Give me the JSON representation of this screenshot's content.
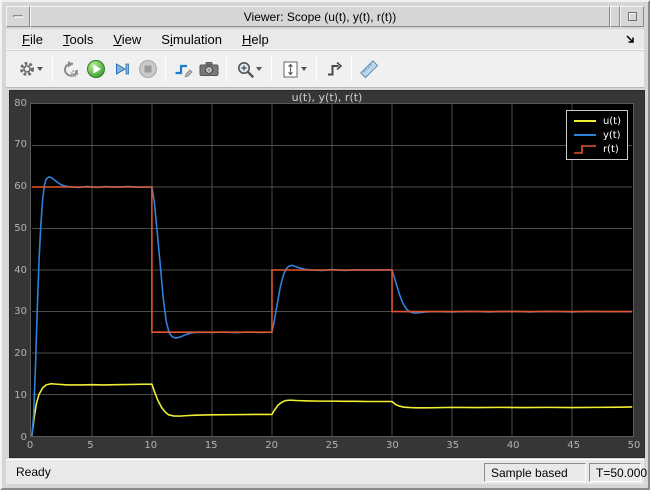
{
  "window": {
    "title": "Viewer: Scope (u(t), y(t), r(t))"
  },
  "menu": {
    "items": [
      {
        "label": "File",
        "mnemonic": 0
      },
      {
        "label": "Tools",
        "mnemonic": 0
      },
      {
        "label": "View",
        "mnemonic": 0
      },
      {
        "label": "Simulation",
        "mnemonic": 1
      },
      {
        "label": "Help",
        "mnemonic": 0
      }
    ]
  },
  "toolbar": {
    "buttons": [
      "settings-gear",
      "step-back",
      "run",
      "step-forward",
      "stop",
      "highlight-simulink-block",
      "snapshot-camera",
      "zoom-in",
      "scale-axes",
      "triggers",
      "measurements-ruler"
    ]
  },
  "status": {
    "left": "Ready",
    "mode": "Sample based",
    "time": "T=50.000"
  },
  "chart_data": {
    "type": "line",
    "title": "u(t), y(t), r(t)",
    "xlim": [
      0,
      50
    ],
    "ylim": [
      0,
      80
    ],
    "xticks": [
      0,
      5,
      10,
      15,
      20,
      25,
      30,
      35,
      40,
      45,
      50
    ],
    "yticks": [
      0,
      10,
      20,
      30,
      40,
      50,
      60,
      70,
      80
    ],
    "grid": true,
    "background": "#000000",
    "grid_color": "#4d4d4d",
    "tick_color": "#b3b3b3",
    "legend_position": "top-right",
    "series": [
      {
        "name": "u(t)",
        "color": "#f0ee33",
        "legend_glyph": "line",
        "points": [
          [
            0,
            0
          ],
          [
            0.2,
            4.5
          ],
          [
            0.4,
            8
          ],
          [
            0.6,
            10
          ],
          [
            0.9,
            11.6
          ],
          [
            1.2,
            12.3
          ],
          [
            1.6,
            12.6
          ],
          [
            2,
            12.5
          ],
          [
            3,
            12.3
          ],
          [
            4,
            12.3
          ],
          [
            5,
            12.35
          ],
          [
            6,
            12.3
          ],
          [
            7,
            12.35
          ],
          [
            8,
            12.4
          ],
          [
            9,
            12.45
          ],
          [
            10,
            12.5
          ],
          [
            10.2,
            10.8
          ],
          [
            10.5,
            8.6
          ],
          [
            10.8,
            6.9
          ],
          [
            11.1,
            5.8
          ],
          [
            11.4,
            5.1
          ],
          [
            11.8,
            4.85
          ],
          [
            12.3,
            4.8
          ],
          [
            12.9,
            4.9
          ],
          [
            13.6,
            5
          ],
          [
            15,
            5.1
          ],
          [
            17,
            5.15
          ],
          [
            19,
            5.2
          ],
          [
            20,
            5.2
          ],
          [
            20.2,
            6.2
          ],
          [
            20.5,
            7.4
          ],
          [
            20.8,
            8.1
          ],
          [
            21.1,
            8.5
          ],
          [
            21.5,
            8.65
          ],
          [
            22,
            8.55
          ],
          [
            23,
            8.45
          ],
          [
            24,
            8.4
          ],
          [
            25,
            8.4
          ],
          [
            26,
            8.35
          ],
          [
            27,
            8.35
          ],
          [
            28,
            8.3
          ],
          [
            29,
            8.3
          ],
          [
            30,
            8.3
          ],
          [
            30.3,
            7.6
          ],
          [
            30.6,
            7.2
          ],
          [
            31,
            6.95
          ],
          [
            31.5,
            6.85
          ],
          [
            32,
            6.8
          ],
          [
            33,
            6.8
          ],
          [
            35,
            6.9
          ],
          [
            37,
            6.85
          ],
          [
            39,
            6.9
          ],
          [
            41,
            6.85
          ],
          [
            43,
            6.9
          ],
          [
            45,
            6.85
          ],
          [
            47,
            6.9
          ],
          [
            49,
            6.95
          ],
          [
            50,
            7
          ]
        ]
      },
      {
        "name": "y(t)",
        "color": "#2f82dc",
        "legend_glyph": "line",
        "points": [
          [
            0,
            0
          ],
          [
            0.15,
            5
          ],
          [
            0.3,
            16
          ],
          [
            0.45,
            30
          ],
          [
            0.6,
            42
          ],
          [
            0.75,
            51
          ],
          [
            0.9,
            57
          ],
          [
            1.05,
            60.5
          ],
          [
            1.2,
            61.9
          ],
          [
            1.4,
            62.4
          ],
          [
            1.6,
            62.3
          ],
          [
            1.8,
            61.9
          ],
          [
            2.1,
            61.2
          ],
          [
            2.4,
            60.6
          ],
          [
            2.8,
            60.2
          ],
          [
            3.2,
            60
          ],
          [
            4,
            59.9
          ],
          [
            4.6,
            60.15
          ],
          [
            5.4,
            59.9
          ],
          [
            6.2,
            60.1
          ],
          [
            7,
            59.95
          ],
          [
            8,
            60.1
          ],
          [
            9,
            59.95
          ],
          [
            10,
            60
          ],
          [
            10.2,
            56.5
          ],
          [
            10.45,
            49
          ],
          [
            10.7,
            41
          ],
          [
            10.95,
            33
          ],
          [
            11.2,
            27.5
          ],
          [
            11.45,
            24.8
          ],
          [
            11.7,
            23.9
          ],
          [
            12,
            23.6
          ],
          [
            12.4,
            23.9
          ],
          [
            12.8,
            24.4
          ],
          [
            13.2,
            24.8
          ],
          [
            13.8,
            25
          ],
          [
            15,
            24.95
          ],
          [
            16,
            25.05
          ],
          [
            17,
            24.9
          ],
          [
            18,
            25.05
          ],
          [
            19,
            24.95
          ],
          [
            20,
            25
          ],
          [
            20.2,
            27.8
          ],
          [
            20.45,
            32
          ],
          [
            20.7,
            36
          ],
          [
            20.95,
            38.8
          ],
          [
            21.2,
            40.3
          ],
          [
            21.45,
            41
          ],
          [
            21.7,
            41.1
          ],
          [
            22,
            40.8
          ],
          [
            22.4,
            40.4
          ],
          [
            22.8,
            40.15
          ],
          [
            23.4,
            40
          ],
          [
            24.2,
            39.9
          ],
          [
            25,
            40.1
          ],
          [
            26,
            39.9
          ],
          [
            27,
            40.05
          ],
          [
            28,
            39.95
          ],
          [
            29,
            40.05
          ],
          [
            30,
            40
          ],
          [
            30.3,
            37.2
          ],
          [
            30.6,
            34.3
          ],
          [
            30.9,
            32
          ],
          [
            31.2,
            30.6
          ],
          [
            31.5,
            29.9
          ],
          [
            31.9,
            29.6
          ],
          [
            32.3,
            29.7
          ],
          [
            32.8,
            29.9
          ],
          [
            33.5,
            30
          ],
          [
            35,
            29.9
          ],
          [
            36.5,
            30.05
          ],
          [
            38,
            29.9
          ],
          [
            40,
            30.05
          ],
          [
            41.5,
            29.9
          ],
          [
            43,
            30.05
          ],
          [
            45,
            29.9
          ],
          [
            46.5,
            30.05
          ],
          [
            48,
            29.95
          ],
          [
            50,
            30
          ]
        ]
      },
      {
        "name": "r(t)",
        "color": "#e2572f",
        "legend_glyph": "step",
        "points": [
          [
            0,
            60
          ],
          [
            10,
            60
          ],
          [
            10,
            25
          ],
          [
            20,
            25
          ],
          [
            20,
            40
          ],
          [
            30,
            40
          ],
          [
            30,
            30
          ],
          [
            50,
            30
          ]
        ]
      }
    ]
  }
}
